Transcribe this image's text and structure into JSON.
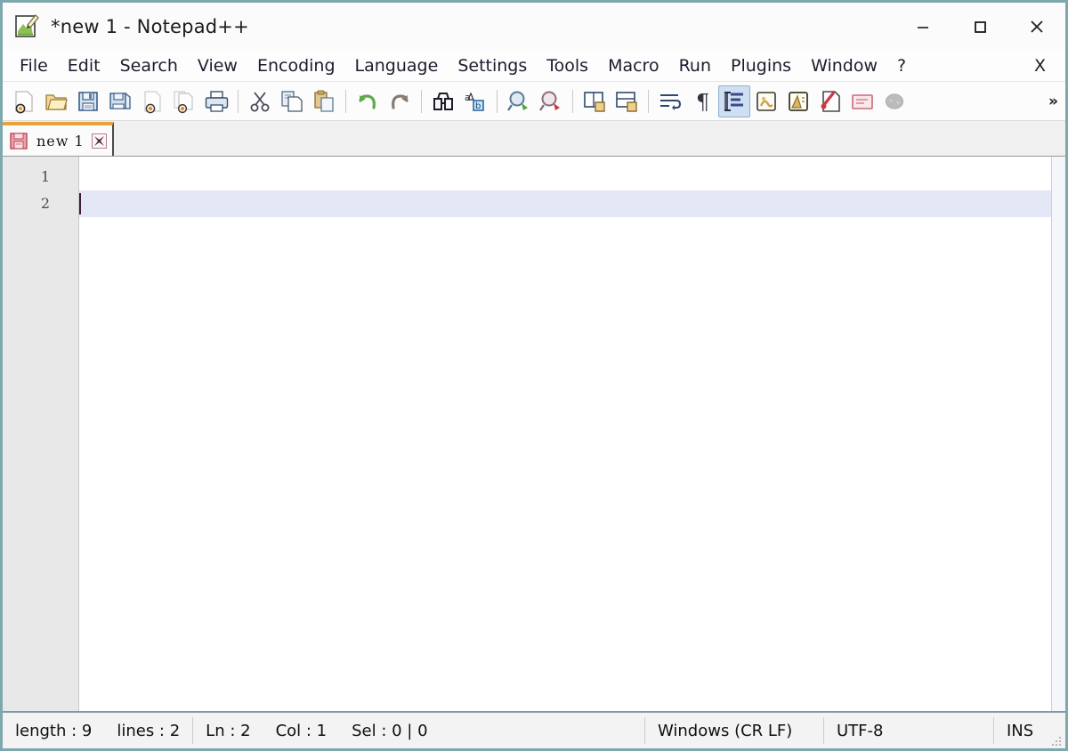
{
  "window": {
    "title": "*new 1 - Notepad++",
    "app_icon": "notepad-plus-plus-icon",
    "controls": {
      "minimize": "—",
      "maximize": "□",
      "close": "✕"
    }
  },
  "menu": {
    "items": [
      {
        "label": "File",
        "name": "file"
      },
      {
        "label": "Edit",
        "name": "edit"
      },
      {
        "label": "Search",
        "name": "search"
      },
      {
        "label": "View",
        "name": "view"
      },
      {
        "label": "Encoding",
        "name": "encoding"
      },
      {
        "label": "Language",
        "name": "language"
      },
      {
        "label": "Settings",
        "name": "settings"
      },
      {
        "label": "Tools",
        "name": "tools"
      },
      {
        "label": "Macro",
        "name": "macro"
      },
      {
        "label": "Run",
        "name": "run"
      },
      {
        "label": "Plugins",
        "name": "plugins"
      },
      {
        "label": "Window",
        "name": "window"
      },
      {
        "label": "?",
        "name": "help"
      }
    ],
    "close_document": "X"
  },
  "toolbar": {
    "overflow_label": "»",
    "buttons": [
      {
        "name": "new-file-icon",
        "title": "New"
      },
      {
        "name": "open-file-icon",
        "title": "Open"
      },
      {
        "name": "save-icon",
        "title": "Save"
      },
      {
        "name": "save-all-icon",
        "title": "Save All"
      },
      {
        "name": "close-file-icon",
        "title": "Close"
      },
      {
        "name": "close-all-files-icon",
        "title": "Close All"
      },
      {
        "name": "print-icon",
        "title": "Print"
      },
      {
        "name": "cut-icon",
        "title": "Cut"
      },
      {
        "name": "copy-icon",
        "title": "Copy"
      },
      {
        "name": "paste-icon",
        "title": "Paste"
      },
      {
        "name": "undo-icon",
        "title": "Undo"
      },
      {
        "name": "redo-icon",
        "title": "Redo"
      },
      {
        "name": "find-icon",
        "title": "Find"
      },
      {
        "name": "replace-icon",
        "title": "Replace"
      },
      {
        "name": "zoom-in-icon",
        "title": "Zoom In"
      },
      {
        "name": "zoom-out-icon",
        "title": "Zoom Out"
      },
      {
        "name": "sync-vertical-scroll-icon",
        "title": "Synchronize Vertical Scrolling"
      },
      {
        "name": "sync-horizontal-scroll-icon",
        "title": "Synchronize Horizontal Scrolling"
      },
      {
        "name": "word-wrap-icon",
        "title": "Word Wrap"
      },
      {
        "name": "show-all-characters-icon",
        "title": "Show All Characters"
      },
      {
        "name": "show-indent-guide-icon",
        "title": "Show Indent Guide",
        "active": true
      },
      {
        "name": "user-defined-dialog-icon",
        "title": "User Defined Dialogue"
      },
      {
        "name": "document-map-icon",
        "title": "Document Map"
      },
      {
        "name": "function-list-icon",
        "title": "Function List"
      },
      {
        "name": "folder-as-workspace-icon",
        "title": "Folder as Workspace"
      },
      {
        "name": "document-monitoring-icon",
        "title": "Document Monitoring"
      }
    ]
  },
  "tabs": [
    {
      "label": "new 1",
      "modified": true,
      "active": true,
      "close_label": "✕"
    }
  ],
  "editor": {
    "line_numbers": [
      "1",
      "2"
    ],
    "lines": [
      "",
      ""
    ],
    "current_line_index": 1,
    "accent_current_line": "#e3e7f6",
    "caret_color": "#3a2030"
  },
  "statusbar": {
    "length": "length : 9",
    "lines": "lines : 2",
    "ln": "Ln : 2",
    "col": "Col : 1",
    "sel": "Sel : 0 | 0",
    "eol": "Windows (CR LF)",
    "encoding": "UTF-8",
    "insert_mode": "INS"
  },
  "colors": {
    "window_border": "#7fa8ad",
    "tab_active_top": "#e8a33d",
    "toolbar_active_bg": "#cfdff2",
    "gutter_bg": "#e8e8e8"
  }
}
